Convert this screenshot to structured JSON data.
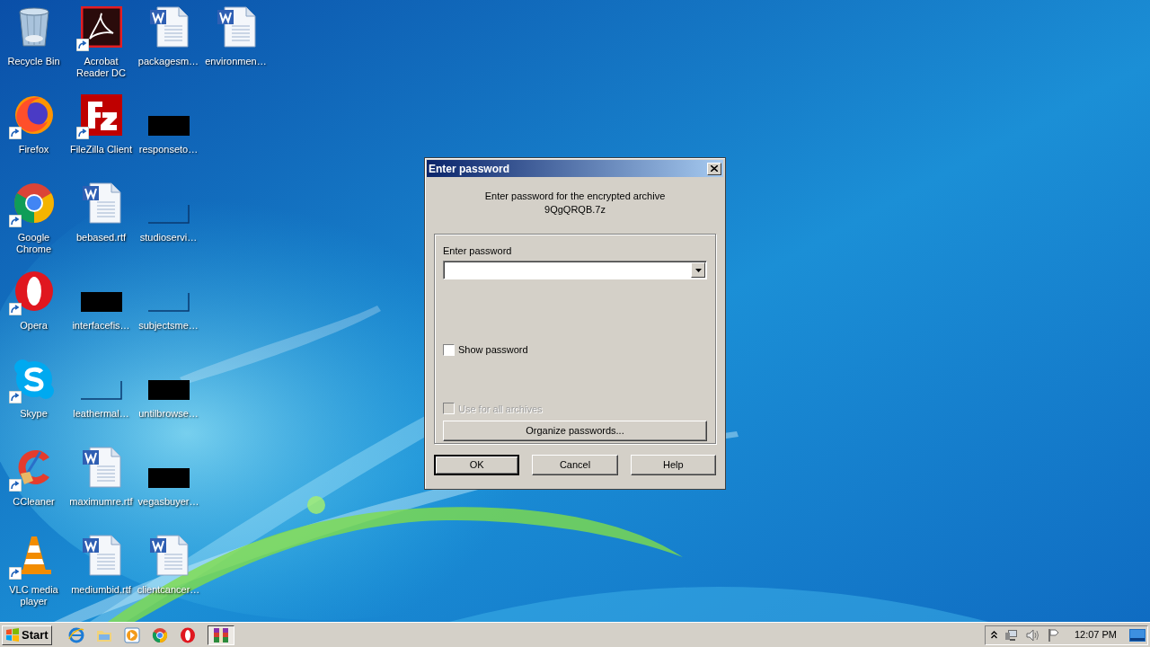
{
  "desktop_icons": [
    {
      "label": "Recycle Bin",
      "kind": "recycle",
      "shortcut": false
    },
    {
      "label": "Firefox",
      "kind": "firefox",
      "shortcut": true
    },
    {
      "label": "Google Chrome",
      "kind": "chrome",
      "shortcut": true
    },
    {
      "label": "Opera",
      "kind": "opera",
      "shortcut": true
    },
    {
      "label": "Skype",
      "kind": "skype",
      "shortcut": true
    },
    {
      "label": "CCleaner",
      "kind": "ccleaner",
      "shortcut": true
    },
    {
      "label": "VLC media player",
      "kind": "vlc",
      "shortcut": true
    },
    {
      "label": "Acrobat Reader DC",
      "kind": "acrobat",
      "shortcut": true
    },
    {
      "label": "FileZilla Client",
      "kind": "filezilla",
      "shortcut": true
    },
    {
      "label": "bebased.rtf",
      "kind": "word",
      "shortcut": false
    },
    {
      "label": "interfacefis…",
      "kind": "redacted",
      "shortcut": false
    },
    {
      "label": "leathermal…",
      "kind": "blank",
      "shortcut": false
    },
    {
      "label": "maximumre.rtf",
      "kind": "word",
      "shortcut": false
    },
    {
      "label": "mediumbid.rtf",
      "kind": "word",
      "shortcut": false
    },
    {
      "label": "packagesm…",
      "kind": "word",
      "shortcut": false
    },
    {
      "label": "responseto…",
      "kind": "redacted",
      "shortcut": false
    },
    {
      "label": "studioservi…",
      "kind": "blank",
      "shortcut": false
    },
    {
      "label": "subjectsme…",
      "kind": "blank",
      "shortcut": false
    },
    {
      "label": "untilbrowse…",
      "kind": "redacted",
      "shortcut": false
    },
    {
      "label": "vegasbuyer…",
      "kind": "redacted",
      "shortcut": false
    },
    {
      "label": "clientcancer…",
      "kind": "word",
      "shortcut": false
    },
    {
      "label": "environmen…",
      "kind": "word",
      "shortcut": false
    }
  ],
  "dialog": {
    "title": "Enter password",
    "message": "Enter password for the encrypted archive",
    "archive": "9QgQRQB.7z",
    "password_label": "Enter password",
    "checkboxes": [
      {
        "label": "Show password",
        "checked": false,
        "disabled": false
      },
      {
        "label": "Use for all archives",
        "checked": false,
        "disabled": true
      }
    ],
    "organize_button": "Organize passwords...",
    "buttons": [
      {
        "label": "OK",
        "default": true
      },
      {
        "label": "Cancel",
        "default": false
      },
      {
        "label": "Help",
        "default": false
      }
    ]
  },
  "taskbar": {
    "start_label": "Start",
    "items": [
      {
        "kind": "ie",
        "active": false
      },
      {
        "kind": "explorer",
        "active": false
      },
      {
        "kind": "media",
        "active": false
      },
      {
        "kind": "chrome",
        "active": false
      },
      {
        "kind": "opera",
        "active": false
      },
      {
        "kind": "winrar",
        "active": true
      }
    ],
    "clock": "12:07 PM"
  }
}
